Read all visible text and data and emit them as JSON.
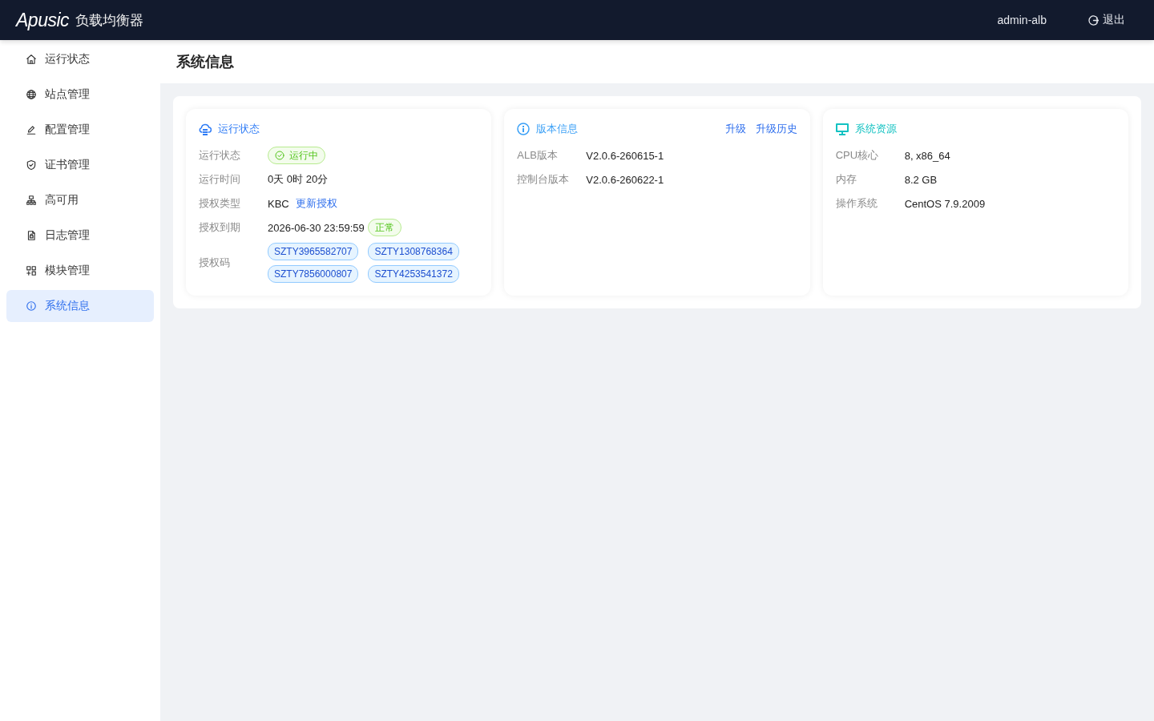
{
  "header": {
    "logo": "Apusic",
    "product": "负载均衡器",
    "user": "admin-alb",
    "logout": "退出"
  },
  "sidebar": {
    "items": [
      {
        "label": "运行状态",
        "selected": false
      },
      {
        "label": "站点管理",
        "selected": false
      },
      {
        "label": "配置管理",
        "selected": false
      },
      {
        "label": "证书管理",
        "selected": false
      },
      {
        "label": "高可用",
        "selected": false
      },
      {
        "label": "日志管理",
        "selected": false
      },
      {
        "label": "模块管理",
        "selected": false
      },
      {
        "label": "系统信息",
        "selected": true
      }
    ]
  },
  "page_title": "系统信息",
  "cards": [
    {
      "title": "运行状态",
      "color": "#2f7cf6",
      "rows": [
        {
          "kind": "field",
          "label": "运行状态",
          "badge": {
            "text": "运行中",
            "check": true
          }
        },
        {
          "kind": "field",
          "label": "运行时间",
          "value": "0天 0时 20分"
        },
        {
          "kind": "field",
          "label": "授权类型",
          "value": "KBC",
          "link": "更新授权"
        },
        {
          "kind": "field",
          "label": "授权到期",
          "value": "2026-06-30 23:59:59",
          "badge": {
            "text": "正常",
            "check": false
          }
        },
        {
          "kind": "tags",
          "label": "授权码",
          "tags": [
            "SZTY3965582707",
            "SZTY1308768364",
            "SZTY7856000807",
            "SZTY4253541372"
          ]
        }
      ]
    },
    {
      "title": "版本信息",
      "color": "#3ba0f6",
      "actions": [
        "升级",
        "升级历史"
      ],
      "rows": [
        {
          "kind": "field",
          "label": "ALB版本",
          "value": "V2.0.6-260615-1"
        },
        {
          "kind": "field",
          "label": "控制台版本",
          "value": "V2.0.6-260622-1"
        }
      ]
    },
    {
      "title": "系统资源",
      "color": "#13c2c2",
      "rows": [
        {
          "kind": "field",
          "label": "CPU核心",
          "value": "8, x86_64"
        },
        {
          "kind": "field",
          "label": "内存",
          "value": "8.2 GB"
        },
        {
          "kind": "field",
          "label": "操作系统",
          "value": "CentOS 7.9.2009"
        }
      ]
    }
  ]
}
